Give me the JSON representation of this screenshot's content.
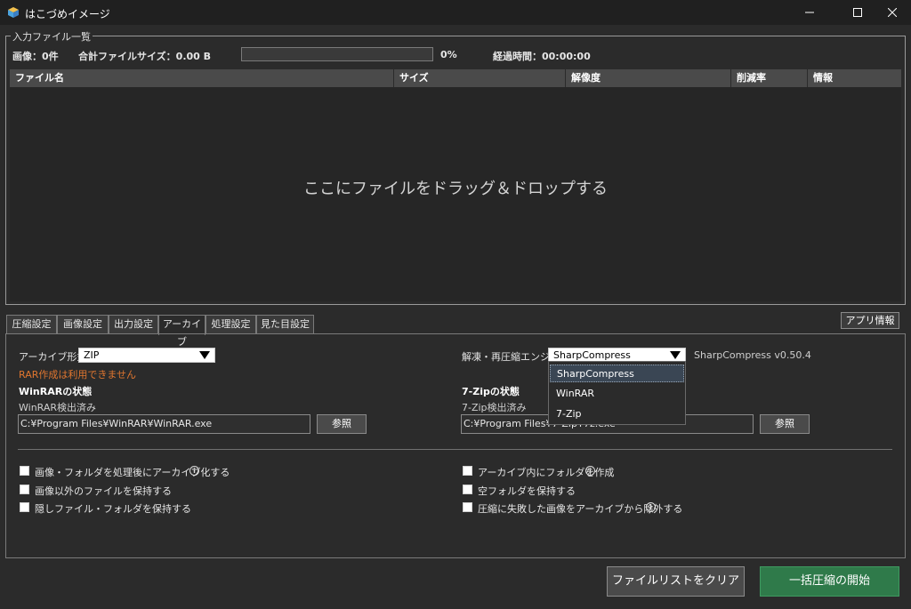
{
  "window": {
    "title": "はこづめイメージ",
    "app_icon": "box-icon",
    "controls": [
      "minimize-icon",
      "maximize-icon",
      "close-icon"
    ]
  },
  "input_group": {
    "legend": "入力ファイル一覧",
    "image_count": "画像：0件",
    "total_size": "合計ファイルサイズ：0.00 B",
    "progress_percent": "0%",
    "progress_value": 0,
    "elapsed": "経過時間：00:00:00",
    "columns": [
      "ファイル名",
      "サイズ",
      "解像度",
      "削減率",
      "情報"
    ],
    "drop_hint": "ここにファイルをドラッグ＆ドロップする"
  },
  "tabs": [
    {
      "label": "圧縮設定"
    },
    {
      "label": "画像設定"
    },
    {
      "label": "出力設定"
    },
    {
      "label": "アーカイブ",
      "active": true
    },
    {
      "label": "処理設定"
    },
    {
      "label": "見た目設定"
    }
  ],
  "about_button": "アプリ情報",
  "archive": {
    "format_label": "アーカイブ形式",
    "format_value": "ZIP",
    "rar_warning": "RAR作成は利用できません",
    "winrar_status_title": "WinRARの状態",
    "winrar_status": "WinRAR検出済み",
    "winrar_path": "C:¥Program Files¥WinRAR¥WinRAR.exe",
    "browse_label": "参照",
    "engine_label": "解凍・再圧縮エンジン",
    "engine_value": "SharpCompress",
    "engine_version": "SharpCompress v0.50.4",
    "engine_options": [
      "SharpCompress",
      "WinRAR",
      "7-Zip"
    ],
    "sevenzip_status_title": "7-Zipの状態",
    "sevenzip_status": "7-Zip検出済み",
    "sevenzip_path": "C:¥Program Files¥7-Zip¥7z.exe"
  },
  "checkboxes_left": [
    {
      "label": "画像・フォルダを処理後にアーカイブ化する",
      "info": true
    },
    {
      "label": "画像以外のファイルを保持する",
      "info": false
    },
    {
      "label": "隠しファイル・フォルダを保持する",
      "info": false
    }
  ],
  "checkboxes_right": [
    {
      "label": "アーカイブ内にフォルダを作成",
      "info": true
    },
    {
      "label": "空フォルダを保持する",
      "info": false
    },
    {
      "label": "圧縮に失敗した画像をアーカイブから除外する",
      "info": true
    }
  ],
  "buttons": {
    "clear": "ファイルリストをクリア",
    "start": "一括圧縮の開始"
  },
  "colors": {
    "start_button": "#2f7a4a",
    "warning_text": "#e0762f"
  }
}
